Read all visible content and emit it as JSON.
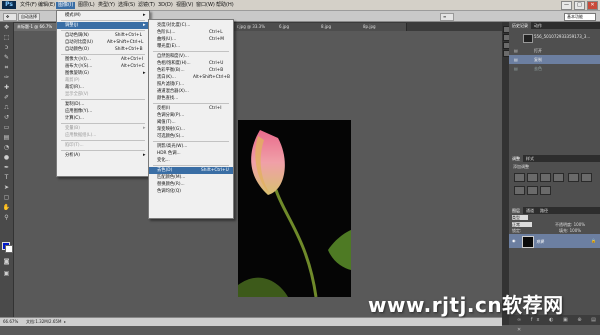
{
  "app": {
    "logo": "Ps"
  },
  "menubar": {
    "items": [
      "文件(F)",
      "编辑(E)",
      "图像(I)",
      "图层(L)",
      "类型(Y)",
      "选择(S)",
      "滤镜(T)",
      "3D(D)",
      "视图(V)",
      "窗口(W)",
      "帮助(H)"
    ],
    "active_index": 2
  },
  "window_controls": {
    "minimize": "—",
    "maximize": "□",
    "close": "✕"
  },
  "options": {
    "auto_select": "自动选择",
    "workspace": "基本功能"
  },
  "tabs": [
    "未标题-1 @ 66.7%",
    "...",
    "r.jpg @ 33.3%",
    "...",
    "6.jpg",
    "...",
    "8.jpg",
    "...",
    "8p.jpg",
    "..."
  ],
  "image_menu": {
    "items": [
      {
        "label": "模式(M)",
        "shortcut": "",
        "submenu": true,
        "disabled": false
      },
      {
        "sep": true
      },
      {
        "label": "调整(J)",
        "shortcut": "",
        "submenu": true,
        "disabled": false,
        "active": true
      },
      {
        "sep": true
      },
      {
        "label": "自动色调(N)",
        "shortcut": "Shift+Ctrl+L",
        "disabled": false
      },
      {
        "label": "自动对比度(U)",
        "shortcut": "Alt+Shift+Ctrl+L",
        "disabled": false
      },
      {
        "label": "自动颜色(O)",
        "shortcut": "Shift+Ctrl+B",
        "disabled": false
      },
      {
        "sep": true
      },
      {
        "label": "图像大小(I)...",
        "shortcut": "Alt+Ctrl+I",
        "disabled": false
      },
      {
        "label": "画布大小(S)...",
        "shortcut": "Alt+Ctrl+C",
        "disabled": false
      },
      {
        "label": "图像旋转(G)",
        "shortcut": "",
        "submenu": true,
        "disabled": false
      },
      {
        "label": "裁剪(P)",
        "shortcut": "",
        "disabled": true
      },
      {
        "label": "裁切(R)...",
        "shortcut": "",
        "disabled": false
      },
      {
        "label": "显示全部(V)",
        "shortcut": "",
        "disabled": true
      },
      {
        "sep": true
      },
      {
        "label": "复制(D)...",
        "shortcut": "",
        "disabled": false
      },
      {
        "label": "应用图像(Y)...",
        "shortcut": "",
        "disabled": false
      },
      {
        "label": "计算(C)...",
        "shortcut": "",
        "disabled": false
      },
      {
        "sep": true
      },
      {
        "label": "变量(B)",
        "shortcut": "",
        "submenu": true,
        "disabled": true
      },
      {
        "label": "应用数据组(L)...",
        "shortcut": "",
        "disabled": true
      },
      {
        "sep": true
      },
      {
        "label": "陷印(T)...",
        "shortcut": "",
        "disabled": true
      },
      {
        "sep": true
      },
      {
        "label": "分析(A)",
        "shortcut": "",
        "submenu": true,
        "disabled": false
      }
    ]
  },
  "adjust_menu": {
    "items": [
      {
        "label": "亮度/对比度(C)...",
        "shortcut": ""
      },
      {
        "label": "色阶(L)...",
        "shortcut": "Ctrl+L"
      },
      {
        "label": "曲线(U)...",
        "shortcut": "Ctrl+M"
      },
      {
        "label": "曝光度(E)...",
        "shortcut": ""
      },
      {
        "sep": true
      },
      {
        "label": "自然饱和度(V)...",
        "shortcut": ""
      },
      {
        "label": "色相/饱和度(H)...",
        "shortcut": "Ctrl+U"
      },
      {
        "label": "色彩平衡(B)...",
        "shortcut": "Ctrl+B"
      },
      {
        "label": "黑白(K)...",
        "shortcut": "Alt+Shift+Ctrl+B"
      },
      {
        "label": "照片滤镜(F)...",
        "shortcut": ""
      },
      {
        "label": "通道混合器(X)...",
        "shortcut": ""
      },
      {
        "label": "颜色查找...",
        "shortcut": ""
      },
      {
        "sep": true
      },
      {
        "label": "反相(I)",
        "shortcut": "Ctrl+I"
      },
      {
        "label": "色调分离(P)...",
        "shortcut": ""
      },
      {
        "label": "阈值(T)...",
        "shortcut": ""
      },
      {
        "label": "渐变映射(G)...",
        "shortcut": ""
      },
      {
        "label": "可选颜色(S)...",
        "shortcut": ""
      },
      {
        "sep": true
      },
      {
        "label": "阴影/高光(W)...",
        "shortcut": ""
      },
      {
        "label": "HDR 色调...",
        "shortcut": ""
      },
      {
        "label": "变化...",
        "shortcut": ""
      },
      {
        "sep": true
      },
      {
        "label": "去色(D)",
        "shortcut": "Shift+Ctrl+U",
        "active": true
      },
      {
        "label": "匹配颜色(M)...",
        "shortcut": ""
      },
      {
        "label": "替换颜色(R)...",
        "shortcut": ""
      },
      {
        "label": "色调均化(Q)",
        "shortcut": ""
      }
    ]
  },
  "history_panel": {
    "tabs": [
      "历史记录",
      "动作"
    ],
    "snapshot": "556_501072933359173_3...",
    "rows": [
      "打开",
      "复制",
      "去色"
    ],
    "selected_index": 1
  },
  "adjustments_panel": {
    "tabs": [
      "调整",
      "样式"
    ],
    "title": "添加调整"
  },
  "layers_panel": {
    "tabs": [
      "图层",
      "通道",
      "路径"
    ],
    "kind": "类型",
    "blend": "正常",
    "opacity": "不透明度: 100%",
    "fill": "填充: 100%",
    "lock": "锁定:",
    "layer_name": "背景"
  },
  "status": {
    "zoom": "66.67%",
    "doc": "文档:1.32M/2.65M"
  },
  "watermark": "www.rjtj.cn软荐网",
  "colors": {
    "accent": "#3a6ea5",
    "foreground": "#0018c8",
    "background": "#ffffff"
  }
}
